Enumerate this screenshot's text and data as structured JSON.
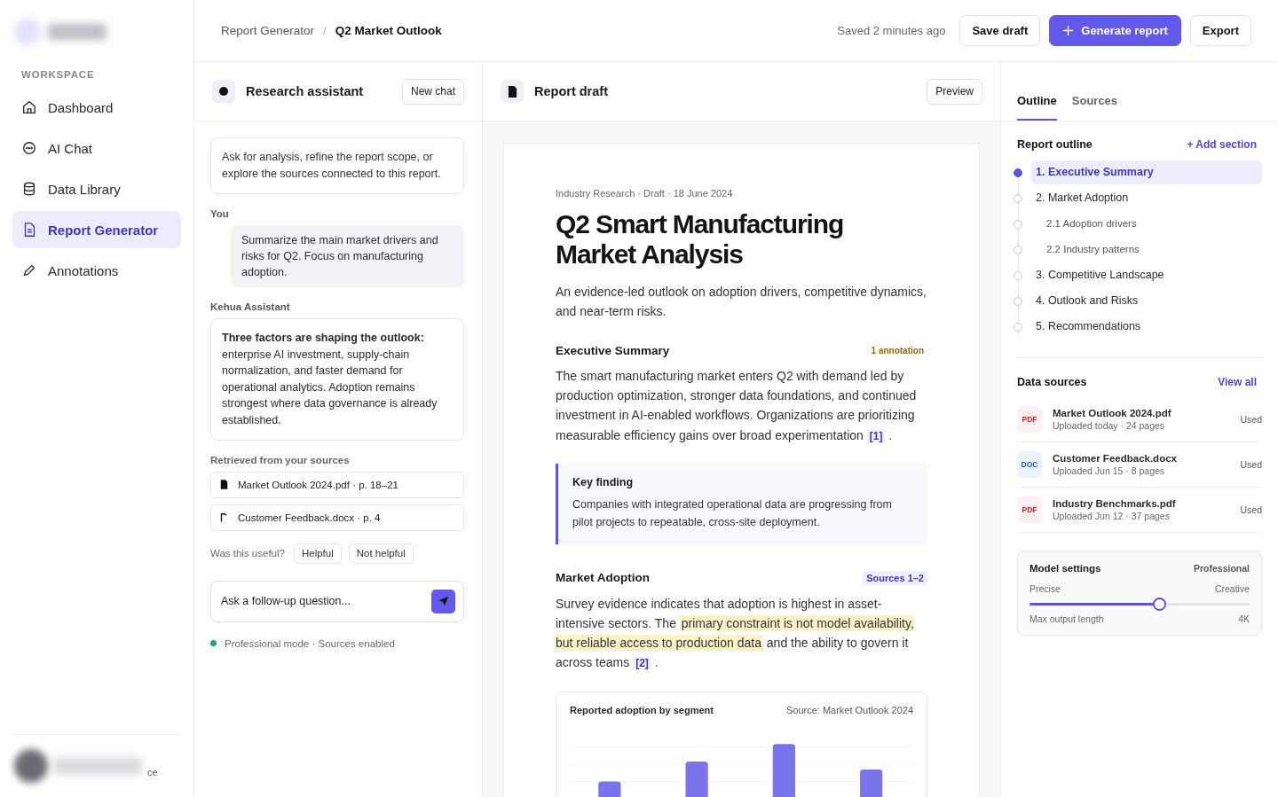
{
  "sidebar": {
    "section_label": "WORKSPACE",
    "items": [
      {
        "label": "Dashboard",
        "selected": false
      },
      {
        "label": "AI Chat",
        "selected": false
      },
      {
        "label": "Data Library",
        "selected": false
      },
      {
        "label": "Report Generator",
        "selected": true
      },
      {
        "label": "Annotations",
        "selected": false
      }
    ],
    "user_fragment": "ce"
  },
  "header": {
    "breadcrumb": [
      {
        "label": "Report Generator",
        "current": false
      },
      {
        "label": "Q2 Market Outlook",
        "current": true
      }
    ],
    "separator": "/",
    "saved": "Saved 2 minutes ago",
    "buttons": [
      {
        "label": "Save draft",
        "kind": "secondary"
      },
      {
        "label": "Generate report",
        "kind": "primary"
      },
      {
        "label": "Export",
        "kind": "secondary"
      }
    ]
  },
  "chat": {
    "title": "Research assistant",
    "new_chat": "New chat",
    "intro": "Ask for analysis, refine the report scope, or explore the sources connected to this report.",
    "you_label": "You",
    "user_message": "Summarize the main market drivers and risks for Q2. Focus on manufacturing adoption.",
    "assistant_label": "Kehua Assistant",
    "assistant_message": "**Three factors are shaping the outlook:** enterprise AI investment, supply-chain normalization, and faster demand for operational analytics. Adoption remains strongest where data governance is already established.",
    "retrieved_label": "Retrieved from your sources",
    "sources": [
      {
        "label": "Market Outlook 2024.pdf · p. 18–21",
        "kind": "pdf"
      },
      {
        "label": "Customer Feedback.docx · p. 4",
        "kind": "doc"
      }
    ],
    "feedback_prompt": "Was this useful?",
    "feedback_buttons": [
      "Helpful",
      "Not helpful"
    ],
    "input_placeholder": "Ask a follow-up question...",
    "status": "Professional mode · Sources enabled"
  },
  "draft": {
    "title": "Report draft",
    "preview": "Preview",
    "meta": "Industry Research · Draft · 18 June 2024",
    "heading": "Q2 Smart Manufacturing Market Analysis",
    "subtitle": "An evidence-led outlook on adoption drivers, competitive dynamics, and near-term risks.",
    "sections": [
      {
        "title": "Executive Summary",
        "badge": "1 annotation",
        "body": [
          {
            "text": "The smart manufacturing market enters Q2 with demand led by production optimization, stronger data foundations, and continued investment in AI-enabled workflows. Organizations are prioritizing measurable efficiency gains over broad experimentation ",
            "kind": "plain"
          },
          {
            "text": "[1]",
            "kind": "cite"
          },
          {
            "text": " .",
            "kind": "plain"
          }
        ],
        "callout": {
          "title": "Key finding",
          "text": "Companies with integrated operational data are progressing from pilot projects to repeatable, cross-site deployment."
        }
      },
      {
        "title": "Market Adoption",
        "badge": "Sources 1–2",
        "body": [
          {
            "text": "Survey evidence indicates that adoption is highest in asset-intensive sectors. The ",
            "kind": "plain"
          },
          {
            "text": "primary constraint is not model availability, but reliable access to production data",
            "kind": "highlight"
          },
          {
            "text": " and the ability to govern it across teams ",
            "kind": "plain"
          },
          {
            "text": "[2]",
            "kind": "cite"
          },
          {
            "text": " .",
            "kind": "plain"
          }
        ],
        "figure": {
          "title": "Reported adoption by segment",
          "source": "Source: Market Outlook 2024"
        }
      }
    ]
  },
  "panel": {
    "tabs": [
      {
        "label": "Outline",
        "selected": true
      },
      {
        "label": "Sources",
        "selected": false
      }
    ],
    "outline_title": "Report outline",
    "add_section": "+ Add section",
    "outline": [
      {
        "label": "1. Executive Summary",
        "selected": true
      },
      {
        "label": "2. Market Adoption",
        "selected": false,
        "children": [
          {
            "label": "2.1 Adoption drivers",
            "selected": false
          },
          {
            "label": "2.2 Industry patterns",
            "selected": false
          }
        ]
      },
      {
        "label": "3. Competitive Landscape",
        "selected": false
      },
      {
        "label": "4. Outlook and Risks",
        "selected": false
      },
      {
        "label": "5. Recommendations",
        "selected": false
      }
    ],
    "sources_title": "Data sources",
    "view_all": "View all",
    "files": [
      {
        "type": "PDF",
        "kind": "pdf",
        "name": "Market Outlook 2024.pdf",
        "meta": "Uploaded today · 24 pages",
        "status": "Used"
      },
      {
        "type": "DOC",
        "kind": "doc",
        "name": "Customer Feedback.docx",
        "meta": "Uploaded Jun 15 · 8 pages",
        "status": "Used"
      },
      {
        "type": "PDF",
        "kind": "pdf",
        "name": "Industry Benchmarks.pdf",
        "meta": "Uploaded Jun 12 · 37 pages",
        "status": "Used"
      }
    ],
    "settings": {
      "title": "Model settings",
      "mode": "Professional",
      "left": "Precise",
      "right": "Creative",
      "level": 0.59,
      "max_label": "Max output length",
      "max_value": "4K"
    }
  }
}
